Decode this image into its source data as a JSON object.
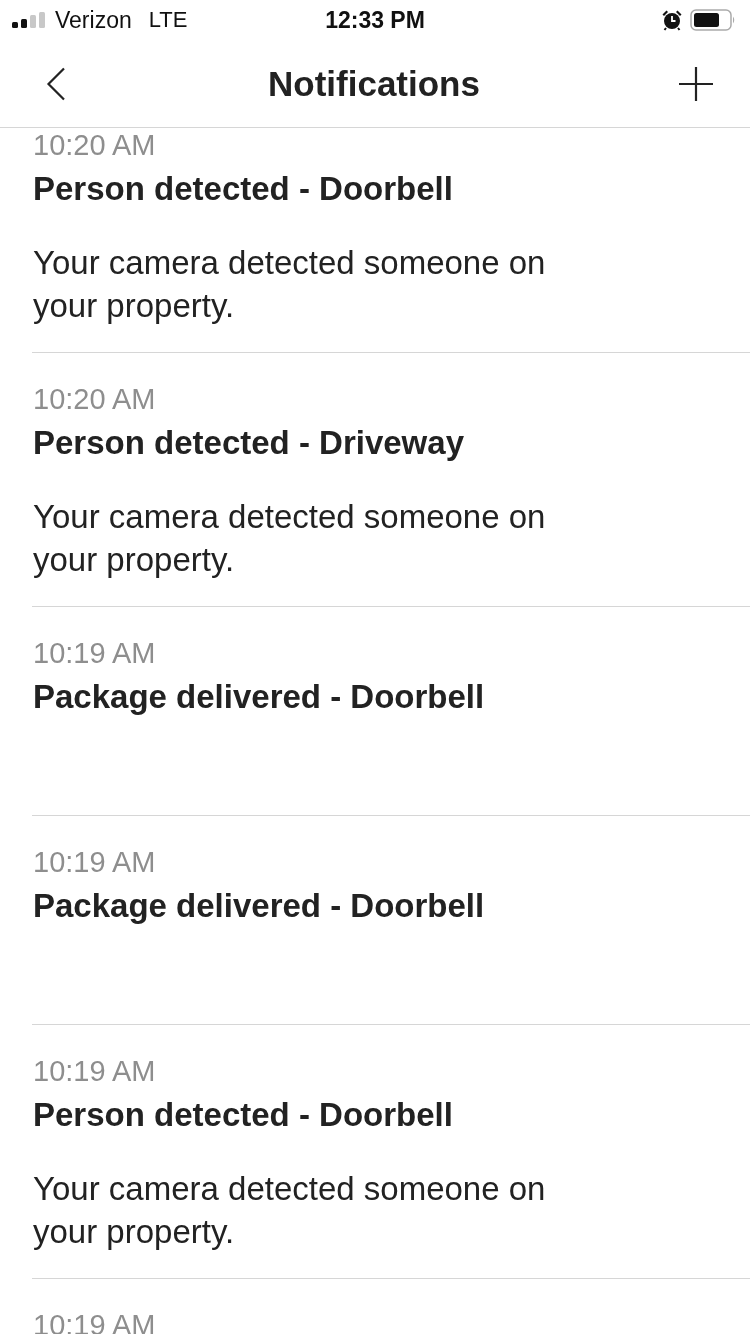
{
  "status_bar": {
    "carrier": "Verizon",
    "network": "LTE",
    "time": "12:33 PM"
  },
  "header": {
    "title": "Notifications"
  },
  "notifications": [
    {
      "time": "10:20 AM",
      "title": "Person detected - Doorbell",
      "body": "Your camera detected someone on your property."
    },
    {
      "time": "10:20 AM",
      "title": "Person detected - Driveway",
      "body": "Your camera detected someone on your property."
    },
    {
      "time": "10:19 AM",
      "title": "Package delivered - Doorbell"
    },
    {
      "time": "10:19 AM",
      "title": "Package delivered - Doorbell"
    },
    {
      "time": "10:19 AM",
      "title": "Person detected - Doorbell",
      "body": "Your camera detected someone on your property."
    },
    {
      "time": "10:19 AM"
    }
  ]
}
